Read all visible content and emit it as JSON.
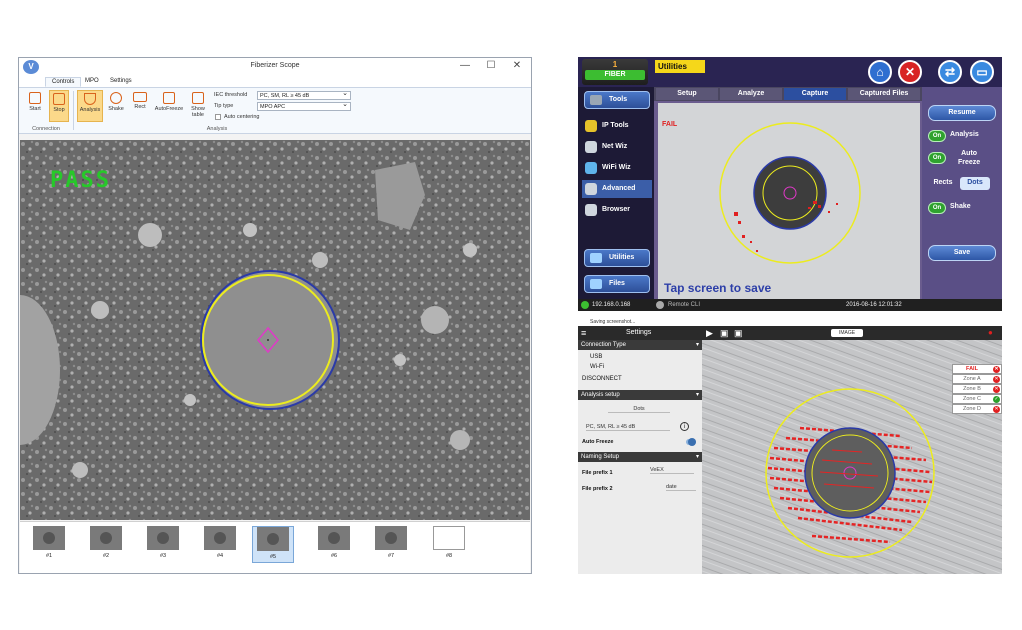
{
  "left_window": {
    "title": "Fiberizer Scope",
    "controls": {
      "minimize": "—",
      "maximize": "☐",
      "close": "✕"
    },
    "tabs": [
      "Controls",
      "MPO",
      "Settings"
    ],
    "active_tab": "Controls",
    "buttons": {
      "start": "Start",
      "stop": "Stop",
      "analysis": "Analysis",
      "shake": "Shake",
      "rect": "Rect",
      "autofreeze": "AutoFreeze",
      "show_table_1": "Show",
      "show_table_2": "table"
    },
    "groups": {
      "connection": "Connection",
      "analysis": "Analysis"
    },
    "fields": {
      "iec_label": "IEC threshold",
      "iec_value": "PC, SM, RL ≥ 45 dB",
      "tip_label": "Tip type",
      "tip_value": "MPO APC",
      "auto_centering": "Auto centering"
    },
    "result": "PASS",
    "thumbnails": [
      "#1",
      "#2",
      "#3",
      "#4",
      "#5",
      "#6",
      "#7",
      "#8"
    ],
    "active_thumbnail": "#5"
  },
  "utilities_window": {
    "fiber_num": "1",
    "fiber_label": "FIBER",
    "title": "Utilities",
    "top_icons": [
      "home-icon",
      "close-icon",
      "swap-icon",
      "folder-icon"
    ],
    "sidebar": {
      "tools": "Tools",
      "items": [
        "IP Tools",
        "Net Wiz",
        "WiFi Wiz",
        "Advanced",
        "Browser"
      ],
      "highlighted": "Advanced",
      "utilities_btn": "Utilities",
      "files_btn": "Files"
    },
    "tabs": [
      "Setup",
      "Analyze",
      "Capture",
      "Captured Files"
    ],
    "active_tab": "Capture",
    "result": "FAIL",
    "tap_message": "Tap screen to save",
    "right_panel": {
      "resume": "Resume",
      "on": "On",
      "analysis": "Analysis",
      "auto_freeze_1": "Auto",
      "auto_freeze_2": "Freeze",
      "rects": "Rects",
      "dots": "Dots",
      "shake": "Shake",
      "save": "Save"
    },
    "status": {
      "ip": "192.168.0.168",
      "remote": "Remote CLI",
      "datetime": "2016-08-16  12:01:32"
    },
    "colors": {
      "accent": "#f5d71a",
      "fail": "#e02020",
      "on": "#2fa22f"
    }
  },
  "settings_window": {
    "notice": "Saving screenshot...",
    "title": "Settings",
    "image_btn": "IMAGE",
    "connection_type": "Connection Type",
    "usb": "USB",
    "wifi": "Wi-Fi",
    "disconnect": "DISCONNECT",
    "analysis_setup": "Analysis setup",
    "dots": "Dots",
    "threshold": "PC, SM, RL ≥ 45 dB",
    "auto_freeze": "Auto Freeze",
    "naming_setup": "Naming Setup",
    "file_prefix_1_label": "File prefix 1",
    "file_prefix_1_value": "VeEX",
    "file_prefix_2_label": "File prefix 2",
    "file_prefix_2_value": "date",
    "zones": [
      {
        "label": "FAIL",
        "status": "fail"
      },
      {
        "label": "Zone A",
        "status": "fail"
      },
      {
        "label": "Zone B",
        "status": "fail"
      },
      {
        "label": "Zone C",
        "status": "pass"
      },
      {
        "label": "Zone D",
        "status": "fail"
      }
    ]
  }
}
